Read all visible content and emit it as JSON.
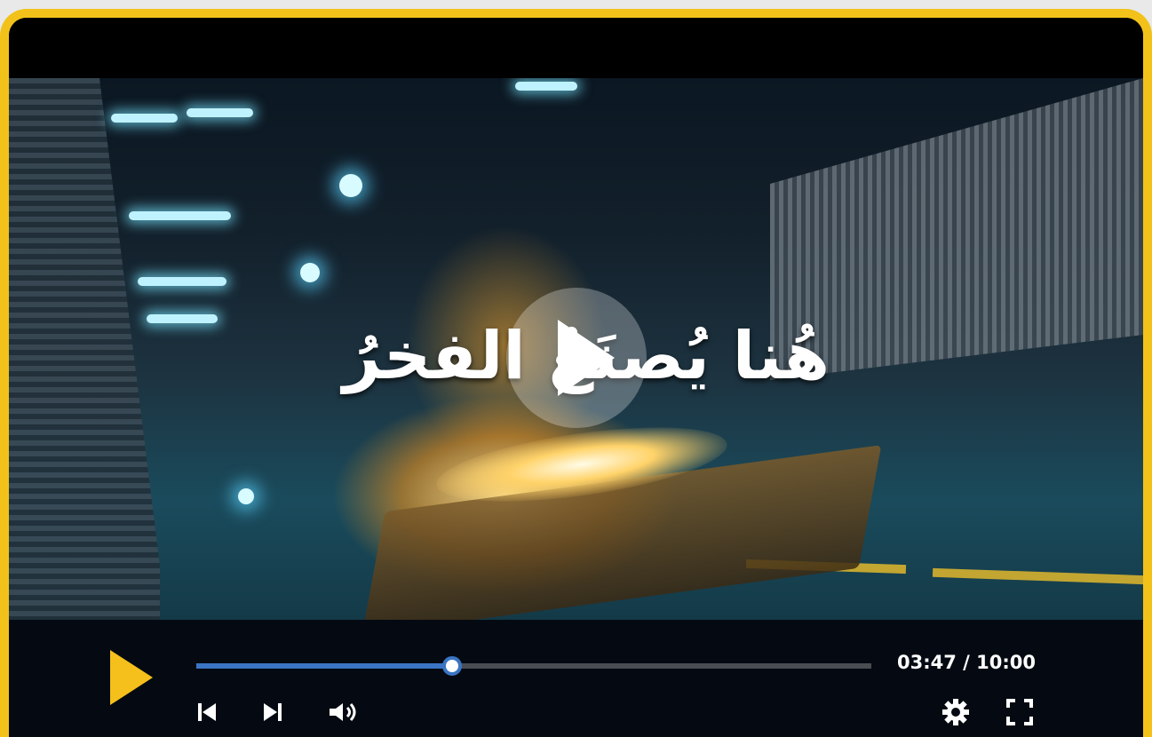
{
  "video": {
    "caption": "هُنا يُصنَعُ الفخرُ"
  },
  "controls": {
    "current_time": "03:47",
    "separator": " / ",
    "duration": "10:00",
    "progress_fraction": 0.3783
  },
  "icons": {
    "play": "play-icon",
    "big_play": "play-icon",
    "previous": "skip-previous-icon",
    "next": "skip-next-icon",
    "volume": "volume-icon",
    "settings": "gear-icon",
    "fullscreen": "fullscreen-icon"
  },
  "colors": {
    "accent": "#f2c21a",
    "progress": "#3a75c4",
    "controls_bg": "#050a12"
  }
}
